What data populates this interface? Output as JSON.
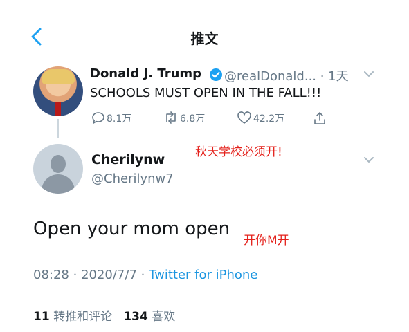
{
  "header": {
    "title": "推文"
  },
  "original_tweet": {
    "display_name": "Donald J. Trump",
    "handle_time": "@realDonald... · 1天",
    "text": "SCHOOLS MUST OPEN IN THE FALL!!!",
    "replies": "8.1万",
    "retweets": "6.8万",
    "likes": "42.2万"
  },
  "reply_tweet": {
    "display_name": "Cherilynw",
    "handle": "@Cherilynw7",
    "text": "Open your mom open",
    "time": "08:28",
    "date": "2020/7/7",
    "source": "Twitter for iPhone",
    "retweet_count": "11",
    "retweet_label": "转推和评论",
    "like_count": "134",
    "like_label": "喜欢"
  },
  "annotations": {
    "translation_1": "秋天学校必须开!",
    "translation_2": "开你M开"
  },
  "colors": {
    "link": "#1b95e0",
    "secondary": "#657786",
    "annotation": "#e4211b",
    "verified": "#1da1f2"
  }
}
